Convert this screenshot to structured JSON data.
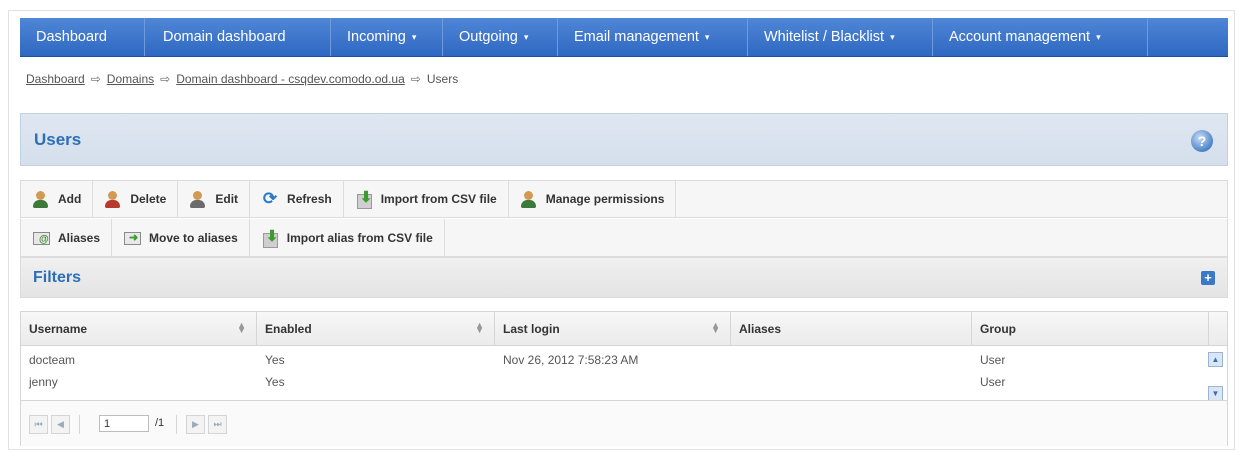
{
  "nav": {
    "items": [
      {
        "label": "Dashboard",
        "dropdown": false
      },
      {
        "label": "Domain dashboard",
        "dropdown": false
      },
      {
        "label": "Incoming",
        "dropdown": true
      },
      {
        "label": "Outgoing",
        "dropdown": true
      },
      {
        "label": "Email management",
        "dropdown": true
      },
      {
        "label": "Whitelist / Blacklist",
        "dropdown": true
      },
      {
        "label": "Account management",
        "dropdown": true
      }
    ],
    "caret": "▾",
    "color": "#3a74cc"
  },
  "breadcrumb": {
    "items": [
      "Dashboard",
      "Domains",
      "Domain dashboard - csqdev.comodo.od.ua"
    ],
    "current": "Users",
    "separator": "⇨"
  },
  "page": {
    "title": "Users",
    "help_icon": "question-mark-icon"
  },
  "toolbar": {
    "row1": [
      "Add",
      "Delete",
      "Edit",
      "Refresh",
      "Import from CSV file",
      "Manage permissions"
    ],
    "row2": [
      "Aliases",
      "Move to aliases",
      "Import alias from CSV file"
    ]
  },
  "filters": {
    "title": "Filters",
    "expand_icon": "plus-icon"
  },
  "grid": {
    "columns": [
      "Username",
      "Enabled",
      "Last login",
      "Aliases",
      "Group"
    ],
    "rows": [
      {
        "username": "docteam",
        "enabled": "Yes",
        "last_login": "Nov 26, 2012 7:58:23 AM",
        "aliases": "",
        "group": "User"
      },
      {
        "username": "jenny",
        "enabled": "Yes",
        "last_login": "",
        "aliases": "",
        "group": "User"
      }
    ]
  },
  "pager": {
    "page": "1",
    "total": "/1"
  }
}
